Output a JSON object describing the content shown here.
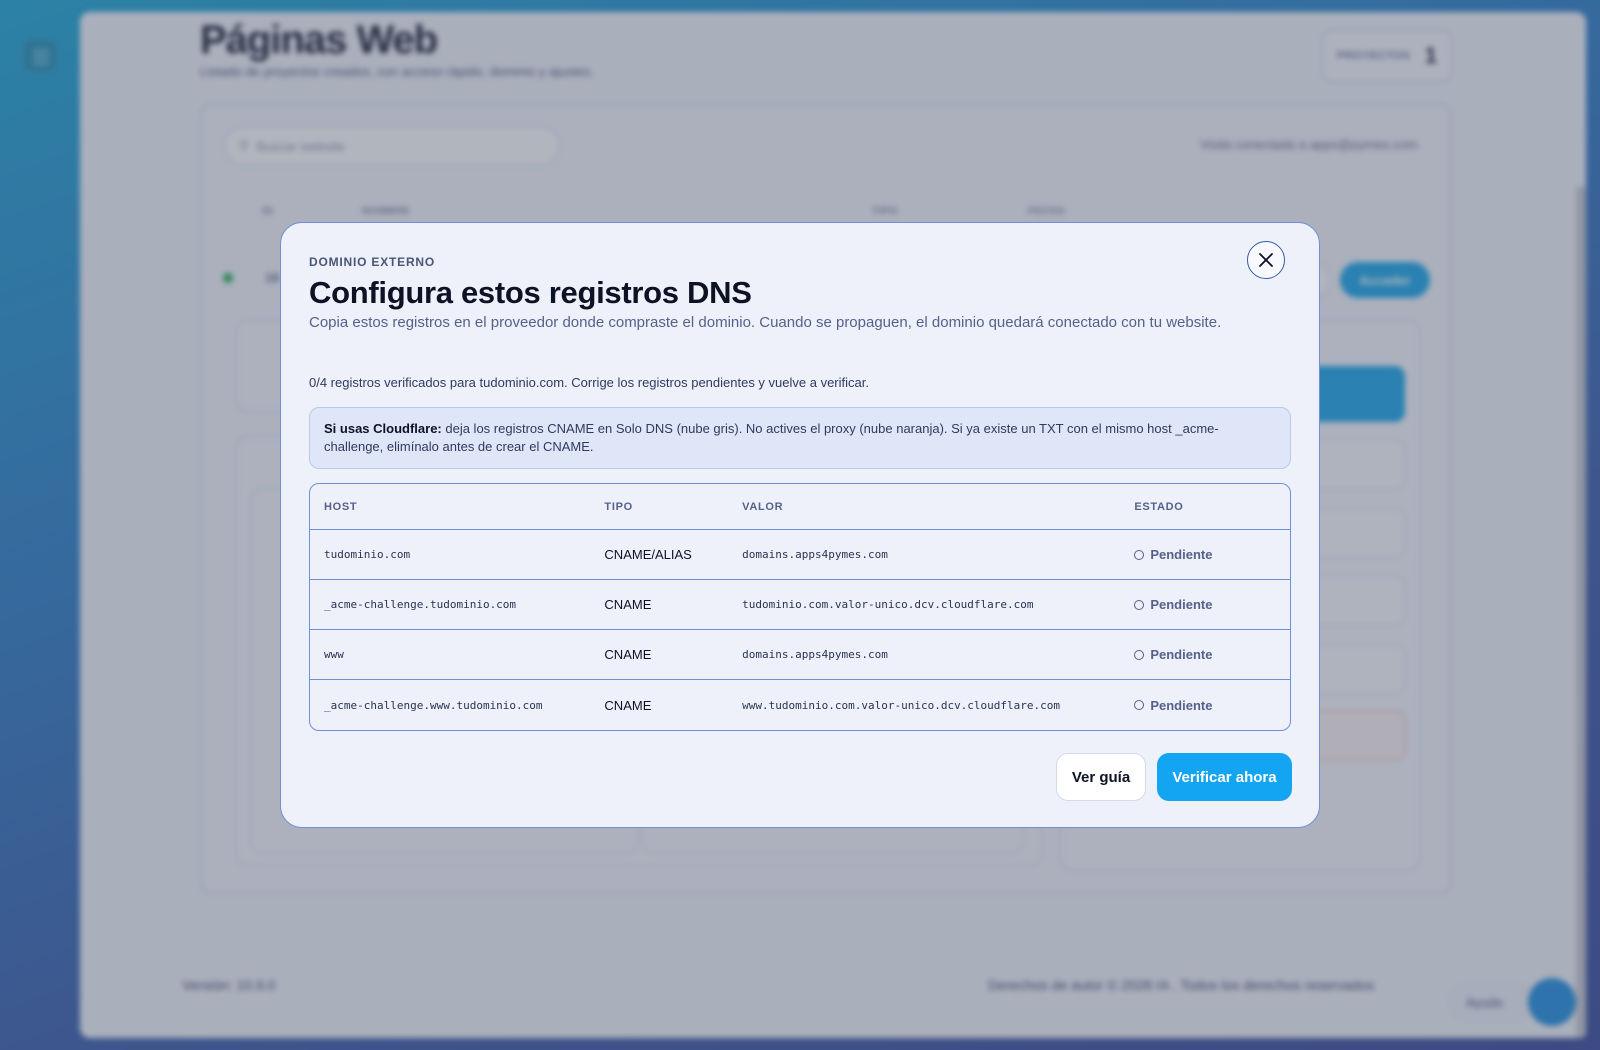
{
  "background": {
    "page_title": "Páginas Web",
    "page_subtitle": "Listado de proyectos creados, con acceso rápido, dominio y ajustes.",
    "projects_label": "PROYECTOS",
    "projects_count": "1",
    "search_placeholder": "Buscar website",
    "visit_text": "Visita conectada a apps@pymes.com",
    "columns": [
      "ID",
      "NOMBRE",
      "TIPO",
      "FECHA"
    ],
    "row_id": "16",
    "access_label": "Acceder",
    "version": "Versión: 10.9.0",
    "copyright": "Derechos de autor © 2026 IA . Todos los derechos reservados",
    "help_label": "Ayuda"
  },
  "modal": {
    "eyebrow": "DOMINIO EXTERNO",
    "title": "Configura estos registros DNS",
    "description": "Copia estos registros en el proveedor donde compraste el dominio. Cuando se propaguen, el dominio quedará conectado con tu website.",
    "progress": "0/4 registros verificados para tudominio.com. Corrige los registros pendientes y vuelve a verificar.",
    "note_strong": "Si usas Cloudflare:",
    "note_text": " deja los registros CNAME en Solo DNS (nube gris). No actives el proxy (nube naranja). Si ya existe un TXT con el mismo host _acme-challenge, elimínalo antes de crear el CNAME.",
    "table": {
      "headers": {
        "host": "HOST",
        "type": "TIPO",
        "value": "VALOR",
        "state": "ESTADO"
      },
      "rows": [
        {
          "host": "tudominio.com",
          "type": "CNAME/ALIAS",
          "value": "domains.apps4pymes.com",
          "state": "Pendiente"
        },
        {
          "host": "_acme-challenge.tudominio.com",
          "type": "CNAME",
          "value": "tudominio.com.valor-unico.dcv.cloudflare.com",
          "state": "Pendiente"
        },
        {
          "host": "www",
          "type": "CNAME",
          "value": "domains.apps4pymes.com",
          "state": "Pendiente"
        },
        {
          "host": "_acme-challenge.www.tudominio.com",
          "type": "CNAME",
          "value": "www.tudominio.com.valor-unico.dcv.cloudflare.com",
          "state": "Pendiente"
        }
      ]
    },
    "guide_button": "Ver guía",
    "verify_button": "Verificar ahora",
    "close_icon": "close-icon"
  },
  "colors": {
    "accent": "#13a4f2",
    "modal_border": "#6d90d8",
    "status_ok": "#1fb052"
  }
}
